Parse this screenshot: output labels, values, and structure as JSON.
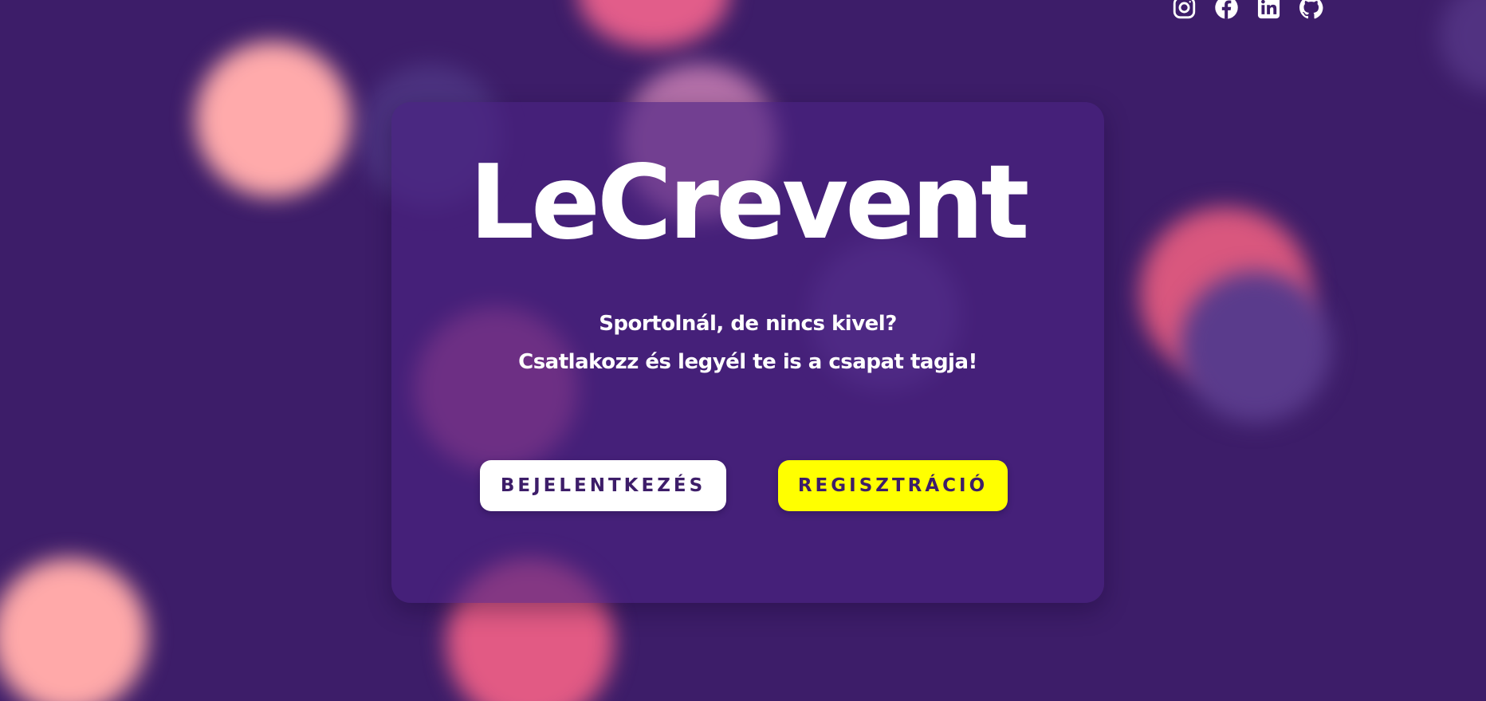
{
  "brand": {
    "name": "LeCrevent"
  },
  "hero": {
    "line1": "Sportolnál, de nincs kivel?",
    "line2": "Csatlakozz és legyél te is a csapat tagja!"
  },
  "actions": {
    "login_label": "BEJELENTKEZÉS",
    "register_label": "REGISZTRÁCIÓ"
  },
  "social": [
    {
      "icon": "instagram-icon"
    },
    {
      "icon": "facebook-icon"
    },
    {
      "icon": "linkedin-icon"
    },
    {
      "icon": "github-icon"
    }
  ],
  "colors": {
    "background": "#3d1d69",
    "card": "#4a2282",
    "accent": "#ffff00",
    "text": "#ffffff",
    "button_text": "#3d1d69"
  }
}
